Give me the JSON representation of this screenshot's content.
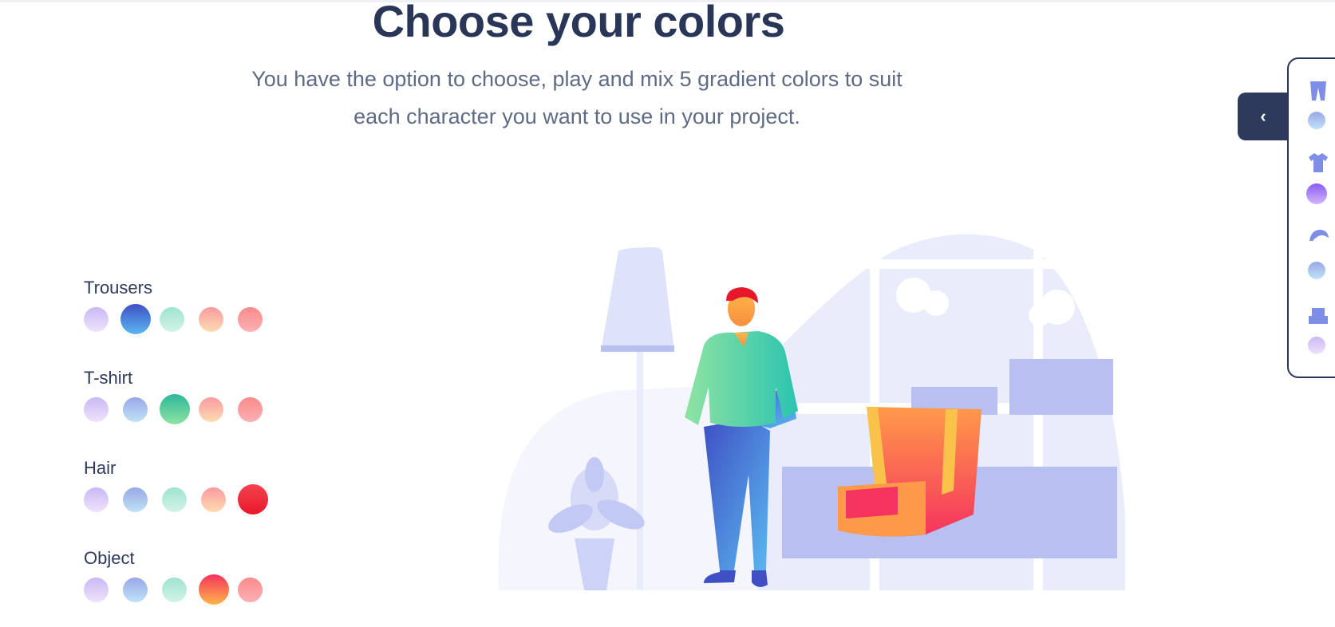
{
  "header": {
    "title": "Choose your colors",
    "subtitle_line1": "You have the option to choose, play and mix 5 gradient colors to suit",
    "subtitle_line2": "each character you want to use in your project."
  },
  "color_groups": [
    {
      "label": "Trousers",
      "swatches": [
        "lilac",
        "blue-deep",
        "mint",
        "peach",
        "salmon"
      ],
      "selected_index": 1
    },
    {
      "label": "T-shirt",
      "swatches": [
        "lilac",
        "blue",
        "green",
        "peach",
        "salmon"
      ],
      "selected_index": 2
    },
    {
      "label": "Hair",
      "swatches": [
        "lilac",
        "blue",
        "mint",
        "peach",
        "red"
      ],
      "selected_index": 4
    },
    {
      "label": "Object",
      "swatches": [
        "lilac",
        "blue",
        "mint",
        "redorange",
        "salmon"
      ],
      "selected_index": 3
    }
  ],
  "side_panel": {
    "toggle_icon": "chevron-left-icon",
    "items": [
      {
        "icon": "trousers-icon"
      },
      {
        "icon": "tshirt-icon"
      },
      {
        "icon": "hair-icon"
      },
      {
        "icon": "armchair-icon"
      }
    ]
  },
  "colors": {
    "heading": "#2a3658",
    "accent_panel": "#2d3a5c",
    "illustration_lavender": "#b8c0f2"
  }
}
